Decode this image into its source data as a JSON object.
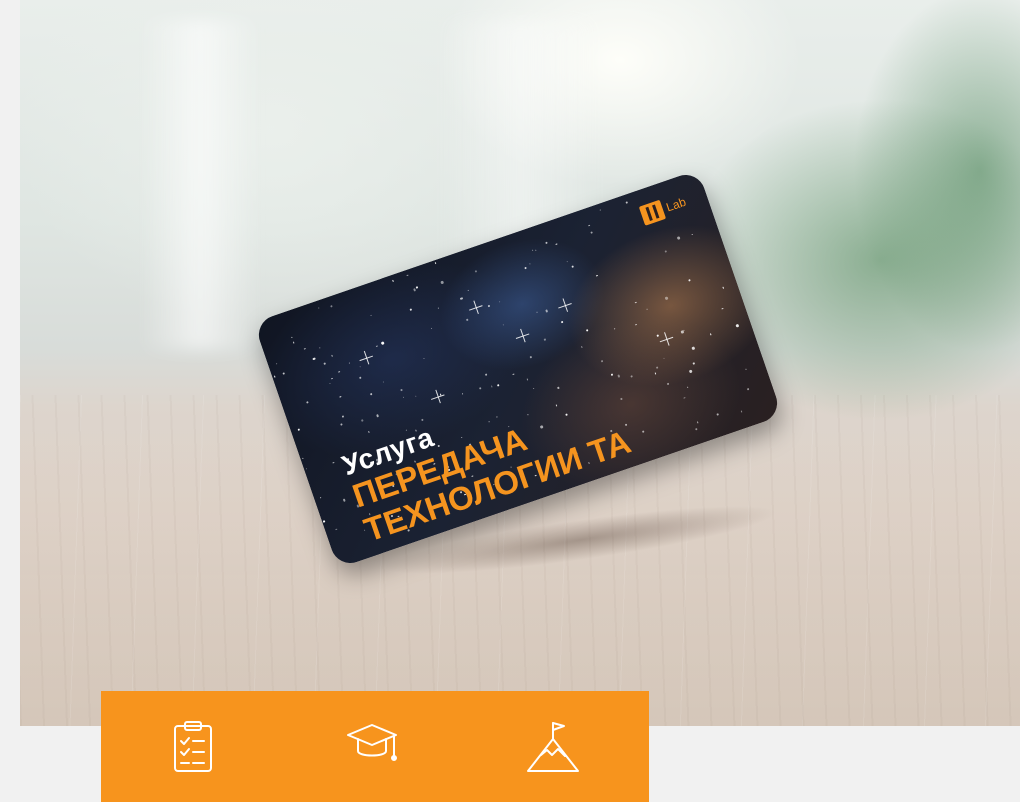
{
  "card": {
    "logo_text": "Lab",
    "subtitle": "Услуга",
    "title_line1": "ПЕРЕДАЧА",
    "title_line2": "ТЕХНОЛОГИИ ТА"
  },
  "features": {
    "icons": [
      "clipboard-checklist-icon",
      "graduation-cap-icon",
      "mountain-flag-icon"
    ]
  },
  "colors": {
    "accent": "#f7941d",
    "card_title": "#f5941f",
    "background": "#f1f1f1"
  }
}
